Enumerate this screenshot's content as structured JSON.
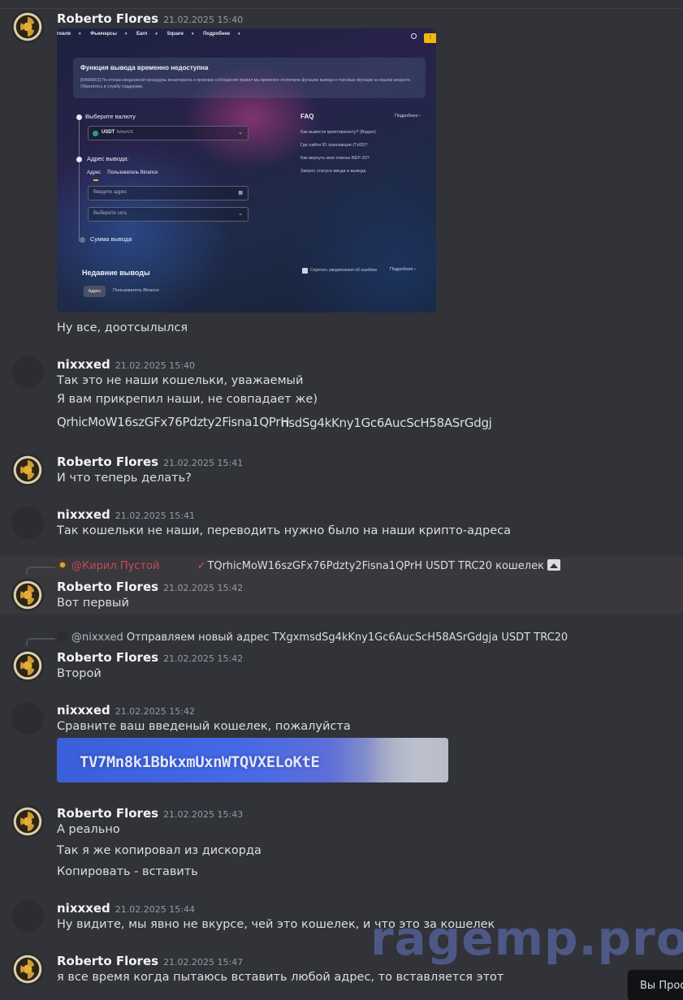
{
  "messages": {
    "m1": {
      "author": "Roberto Flores",
      "time": "21.02.2025 15:40",
      "screenshot": {
        "nav": [
          "говля",
          "Фьючерсы",
          "Earn",
          "Square",
          "Подробнее"
        ],
        "alert_title": "Функция вывода временно недоступна",
        "alert_text": "[RAM0001] По итогам ежедневной процедуры мониторинга и проверки соблюдения правил мы временно отключили функцию вывода и торговые функции на вашем аккаунте. Обратитесь в службу поддержки.",
        "step1_label": "Выберите валюту",
        "coin_value": "USDT",
        "coin_sub": "TetherUS",
        "step2_label": "Адрес вывода:",
        "tab_address": "Адрес",
        "tab_user": "Пользователь Binance",
        "address_placeholder": "Введите адрес",
        "network_placeholder": "Выберите сеть",
        "step3_label": "Сумма вывода",
        "faq_title": "FAQ",
        "faq_more": "Подробнее",
        "faq_items": [
          "Как вывести криптовалюту? (Видео)",
          "Где найти ID транзакции (TxID)?",
          "Как вернуть мои токены BEP-20?",
          "Запрос статуса ввода и вывода"
        ],
        "recent_title": "Недавние выводы",
        "hide_errors": "Спрятать уведомления об ошибках",
        "recent_more": "Подробнее",
        "pill_address": "Адрес",
        "pill_user": "Пользователь Binance"
      },
      "text": "Ну все, доотсылылся"
    },
    "m2": {
      "author": "nixxxed",
      "time": "21.02.2025 15:40",
      "lines": [
        "Так это не наши кошельки, уважаемый",
        "Я вам прикрепил наши, не совпадает же)"
      ],
      "wallet_a": "QrhicMoW16szGFx76Pdzty2Fisna1QPrH",
      "wallet_b": "nsdSg4kKny1Gc6AucScH58ASrGdgj"
    },
    "m3": {
      "author": "Roberto Flores",
      "time": "21.02.2025 15:41",
      "text": "И что теперь делать?"
    },
    "m4": {
      "author": "nixxxed",
      "time": "21.02.2025 15:41",
      "text": "Так кошельки не наши, переводить нужно было на наши крипто-адреса"
    },
    "m5": {
      "reply_mention": "@Кирил Пустой",
      "reply_check": "✓",
      "reply_text": "TQrhicMoW16szGFx76Pdzty2Fisna1QPrH  USDT TRC20 кошелек",
      "author": "Roberto Flores",
      "time": "21.02.2025 15:42",
      "text": "Вот первый"
    },
    "m6": {
      "reply_mention": "@nixxxed",
      "reply_text": "Отправляем новый адрес  TXgxmsdSg4kKny1Gc6AucScH58ASrGdgja  USDT TRC20",
      "author": "Roberto Flores",
      "time": "21.02.2025 15:42",
      "text": "Второй"
    },
    "m7": {
      "author": "nixxxed",
      "time": "21.02.2025 15:42",
      "text": "Сравните ваш введеный кошелек, пожалуйста",
      "wallet_image_text": "TV7Mn8k1BbkxmUxnWTQVXELoKtE"
    },
    "m8": {
      "author": "Roberto Flores",
      "time": "21.02.2025 15:43",
      "lines": [
        "А реально",
        "Так я же копировал из дискорда",
        "Копировать - вставить"
      ]
    },
    "m9": {
      "author": "nixxxed",
      "time": "21.02.2025 15:44",
      "text": "Ну видите, мы явно не вкурсе, чей это кошелек, и что это за кошелек"
    },
    "m10": {
      "author": "Roberto Flores",
      "time": "21.02.2025 15:47",
      "text": "я все время когда пытаюсь вставить любой адрес, то вставляется этот"
    }
  },
  "watermark": "ragemp.pro",
  "floating_button": "Вы Просм",
  "colors": {
    "background": "#313338",
    "author": "#f2f3f5",
    "timestamp": "#949ba4",
    "mention_red": "#c64c5c",
    "highlight_row": "#39383c"
  }
}
